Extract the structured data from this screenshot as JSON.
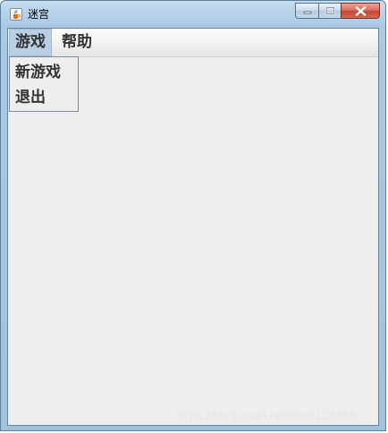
{
  "window": {
    "title": "迷宫",
    "icon": "java-cup-icon"
  },
  "caption_buttons": {
    "minimize": "minimize-icon",
    "maximize": "maximize-icon",
    "close": "close-icon"
  },
  "menubar": {
    "menus": [
      {
        "label": "游戏",
        "active": true
      },
      {
        "label": "帮助",
        "active": false
      }
    ]
  },
  "dropdown": {
    "items": [
      {
        "label": "新游戏"
      },
      {
        "label": "退出"
      }
    ]
  },
  "watermark": "https://blog.csdn.net/dkm123456",
  "colors": {
    "client_bg": "#eeeeee",
    "menu_active_bg": "#b8cfe5",
    "close_button": "#c44631",
    "text": "#333333"
  }
}
